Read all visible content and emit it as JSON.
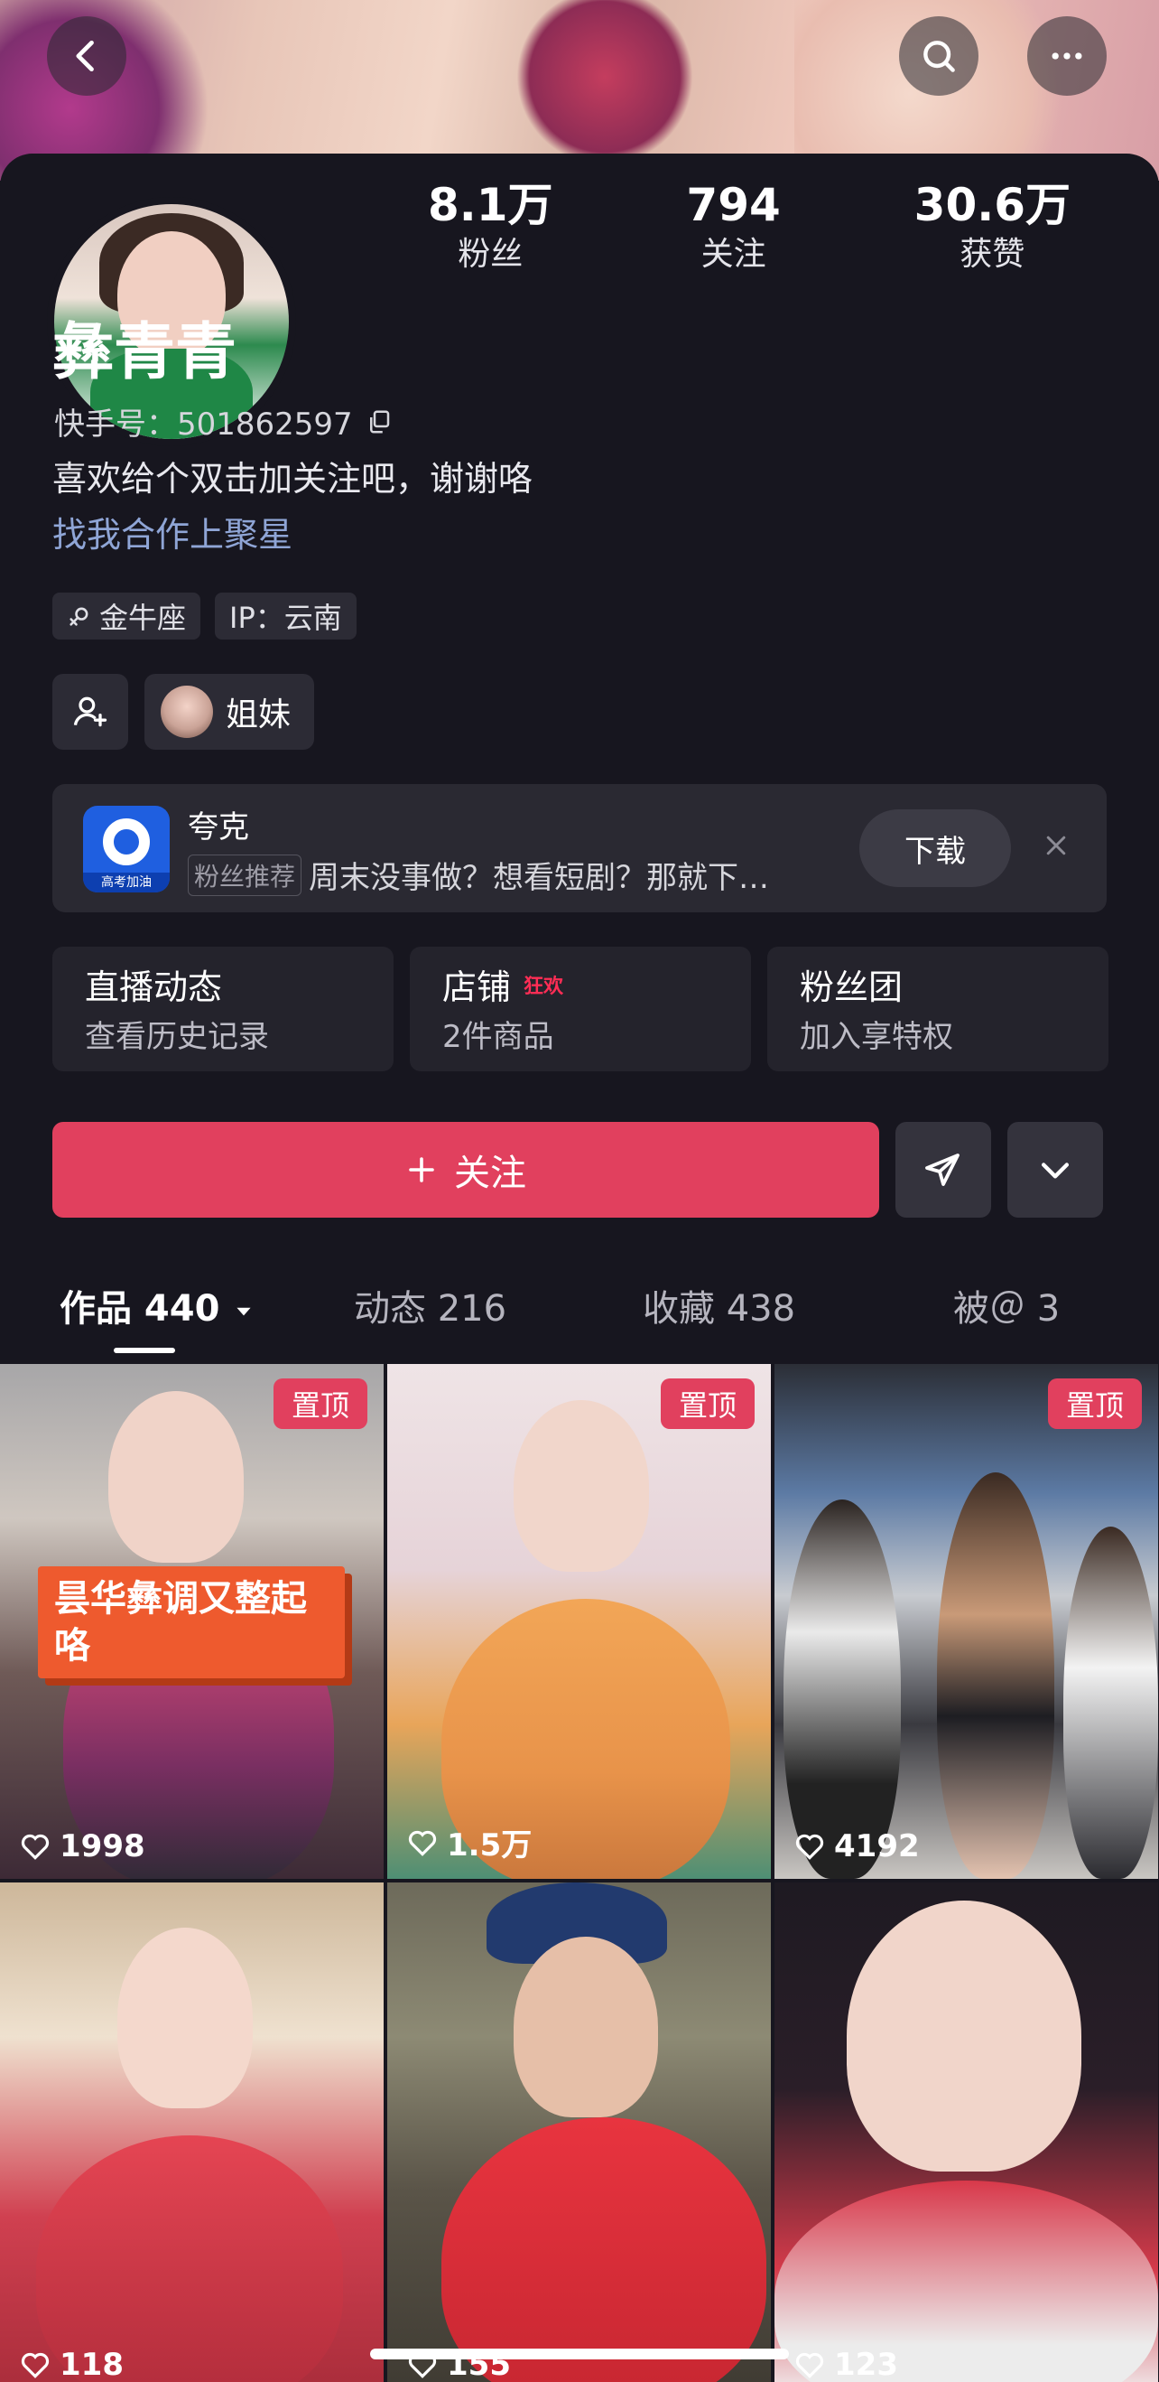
{
  "header": {
    "back_icon": "chevron-left-icon",
    "search_icon": "search-icon",
    "more_icon": "more-dots-icon"
  },
  "profile": {
    "name": "彝青青",
    "kuaishou_id": "快手号：501862597",
    "bio": "喜欢给个双击加关注吧，谢谢咯",
    "coop_link": "找我合作上聚星",
    "tags": [
      {
        "icon": "gender-female-icon",
        "label": "金牛座"
      },
      {
        "label": "IP：云南"
      }
    ],
    "friend_label": "姐妹"
  },
  "stats": [
    {
      "num": "8.1万",
      "label": "粉丝"
    },
    {
      "num": "794",
      "label": "关注"
    },
    {
      "num": "30.6万",
      "label": "获赞"
    }
  ],
  "ad": {
    "app_name": "夸克",
    "logo_caption": "高考加油",
    "badge": "粉丝推荐",
    "text": "周末没事做？想看短剧？那就下…",
    "download_label": "下载"
  },
  "cards": [
    {
      "title": "直播动态",
      "sub": "查看历史记录"
    },
    {
      "title": "店铺",
      "hot": "狂欢",
      "sub": "2件商品"
    },
    {
      "title": "粉丝团",
      "sub": "加入享特权"
    }
  ],
  "actions": {
    "follow_label": "关注"
  },
  "tabs": [
    {
      "label": "作品 440"
    },
    {
      "label": "动态 216"
    },
    {
      "label": "收藏 438"
    },
    {
      "label": "被＠ 3"
    }
  ],
  "videos": [
    {
      "pinned": "置顶",
      "likes": "1998",
      "overlay": "昙华彝调又整起咯"
    },
    {
      "pinned": "置顶",
      "likes": "1.5万"
    },
    {
      "pinned": "置顶",
      "likes": "4192"
    },
    {
      "likes": "118"
    },
    {
      "likes": "155"
    },
    {
      "likes": "123"
    }
  ],
  "colors": {
    "accent": "#e1405e",
    "background": "#17161f",
    "link": "#8fa5d6"
  }
}
